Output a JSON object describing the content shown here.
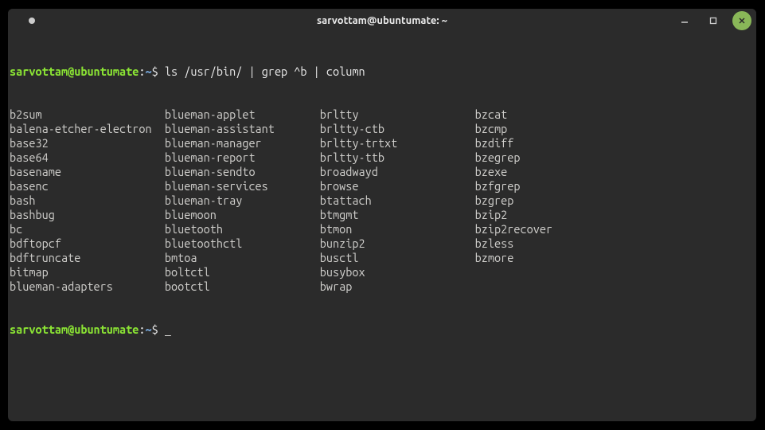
{
  "titlebar": {
    "title": "sarvottam@ubuntumate: ~"
  },
  "prompt1": {
    "user": "sarvottam@ubuntumate",
    "colon": ":",
    "path": "~",
    "dollar": "$",
    "command": " ls /usr/bin/ | grep ^b | column"
  },
  "output": {
    "rows": [
      [
        "b2sum",
        "blueman-applet",
        "brltty",
        "bzcat"
      ],
      [
        "balena-etcher-electron",
        "blueman-assistant",
        "brltty-ctb",
        "bzcmp"
      ],
      [
        "base32",
        "blueman-manager",
        "brltty-trtxt",
        "bzdiff"
      ],
      [
        "base64",
        "blueman-report",
        "brltty-ttb",
        "bzegrep"
      ],
      [
        "basename",
        "blueman-sendto",
        "broadwayd",
        "bzexe"
      ],
      [
        "basenc",
        "blueman-services",
        "browse",
        "bzfgrep"
      ],
      [
        "bash",
        "blueman-tray",
        "btattach",
        "bzgrep"
      ],
      [
        "bashbug",
        "bluemoon",
        "btmgmt",
        "bzip2"
      ],
      [
        "bc",
        "bluetooth",
        "btmon",
        "bzip2recover"
      ],
      [
        "bdftopcf",
        "bluetoothctl",
        "bunzip2",
        "bzless"
      ],
      [
        "bdftruncate",
        "bmtoa",
        "busctl",
        "bzmore"
      ],
      [
        "bitmap",
        "boltctl",
        "busybox",
        ""
      ],
      [
        "blueman-adapters",
        "bootctl",
        "bwrap",
        ""
      ]
    ]
  },
  "prompt2": {
    "user": "sarvottam@ubuntumate",
    "colon": ":",
    "path": "~",
    "dollar": "$",
    "cursor": " _"
  }
}
